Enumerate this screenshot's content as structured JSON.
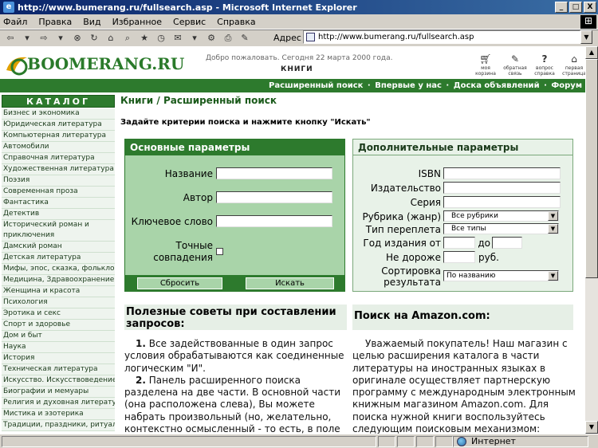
{
  "window": {
    "title": "http://www.bumerang.ru/fullsearch.asp - Microsoft Internet Explorer",
    "min": "_",
    "max": "□",
    "close": "X"
  },
  "menu": [
    "Файл",
    "Правка",
    "Вид",
    "Избранное",
    "Сервис",
    "Справка"
  ],
  "address": {
    "label": "Адрес",
    "url": "http://www.bumerang.ru/fullsearch.asp"
  },
  "status": {
    "zone": "Интернет"
  },
  "header": {
    "logo": "BOOMERANG.RU",
    "welcome": "Добро пожаловать. Сегодня 22 марта 2000 года.",
    "section": "КНИГИ",
    "icons": [
      {
        "icon": "cart-icon",
        "label": "моя корзина"
      },
      {
        "icon": "feedback-icon",
        "label": "обратная связь"
      },
      {
        "icon": "help-icon",
        "label": "вопрос справка"
      },
      {
        "icon": "home-icon",
        "label": "первая страница"
      }
    ]
  },
  "navbar": {
    "links": [
      "Расширенный поиск",
      "Впервые у нас",
      "Доска объявлений",
      "Форум"
    ],
    "sep": "·"
  },
  "catalog": {
    "title": "КАТАЛОГ",
    "items": [
      "Бизнес и экономика",
      "Юридическая литература",
      "Компьютерная литература",
      "Автомобили",
      "Справочная литература",
      "Художественная литература",
      "Поэзия",
      "Современная проза",
      "Фантастика",
      "Детектив",
      "Исторический роман и приключения",
      "Дамский роман",
      "Детская литература",
      "Мифы, эпос, сказка, фольклор",
      "Медицина, Здравоохранение",
      "Женщина и красота",
      "Психология",
      "Эротика и секс",
      "Спорт и здоровье",
      "Дом и быт",
      "Наука",
      "История",
      "Техническая литература",
      "Искусство. Искусствоведение",
      "Биографии и мемуары",
      "Религия и духовная литература",
      "Мистика и эзотерика",
      "Традиции, праздники, ритуалы"
    ]
  },
  "page": {
    "title": "Книги",
    "title_sep": " / ",
    "subtitle": "Расширенный поиск",
    "instruction": "Задайте критерии поиска и нажмите кнопку \"Искать\""
  },
  "main_panel": {
    "title": "Основные параметры",
    "title_label": "Название",
    "author_label": "Автор",
    "keyword_label": "Ключевое слово",
    "exact_label_1": "Точные",
    "exact_label_2": "совпадения",
    "reset": "Сбросить",
    "search": "Искать"
  },
  "extra_panel": {
    "title": "Дополнительные параметры",
    "isbn": "ISBN",
    "publisher": "Издательство",
    "series": "Серия",
    "rubric": "Рубрика (жанр)",
    "rubric_value": "Все рубрики",
    "binding": "Тип переплета",
    "binding_value": "Все типы",
    "year": "Год издания от",
    "to": "до",
    "price": "Не дороже",
    "currency": "руб.",
    "sort_1": "Сортировка",
    "sort_2": "результата",
    "sort_value": "По названию"
  },
  "tips": {
    "title": "Полезные советы при составлении запросов:",
    "p1_num": "1.",
    "p1": "Все задействованные в один запрос условия обрабатываются как соединенные логическим \"И\".",
    "p2_num": "2.",
    "p2": "Панель расширенного поиска разделена на две части. В основной части (она расположена слева), Вы можете набрать произвольный (но, желательно, контекстно осмысленный - то есть, в поле \"Автор\" хорошо"
  },
  "amazon": {
    "title": "Поиск на Amazon.com:",
    "text": "Уважаемый покупатель! Наш магазин с целью расширения каталога в части литературы на иностранных языках в оригинале осуществляет партнерскую программу с международным электронным книжным магазином Amazon.com. Для поиска нужной книги воспользуйтесь следующим поисковым механизмом:"
  }
}
